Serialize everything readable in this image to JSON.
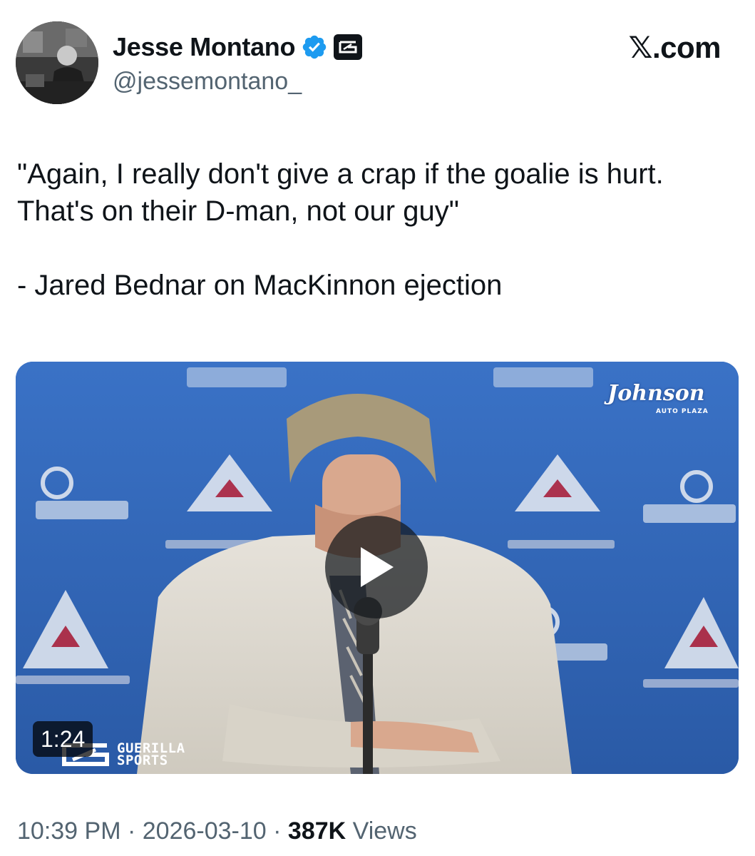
{
  "author": {
    "display_name": "Jesse Montano",
    "handle": "@jessemontano_",
    "verified": true,
    "avatar_icon": "profile-photo",
    "affiliate_icon": "guerilla-sports-badge-icon"
  },
  "source": {
    "label": "𝕏.com"
  },
  "tweet": {
    "lines": [
      "\"Again, I really don't give a crap if the goalie is hurt. That's on their D-man, not our guy\"",
      "- Jared Bednar on MacKinnon ejection"
    ]
  },
  "media": {
    "type": "video",
    "duration": "1:24",
    "watermark_left": "GUERILLA\nSPORTS",
    "watermark_right": "Johnson",
    "watermark_right_sub": "AUTO PLAZA",
    "background_color": "#2f63b5"
  },
  "meta": {
    "time": "10:39 PM",
    "separator": "·",
    "date": "2026-03-10",
    "views_count": "387K",
    "views_label": "Views"
  },
  "colors": {
    "text_primary": "#0f1419",
    "text_secondary": "#536471",
    "verified_blue": "#1d9bf0"
  }
}
